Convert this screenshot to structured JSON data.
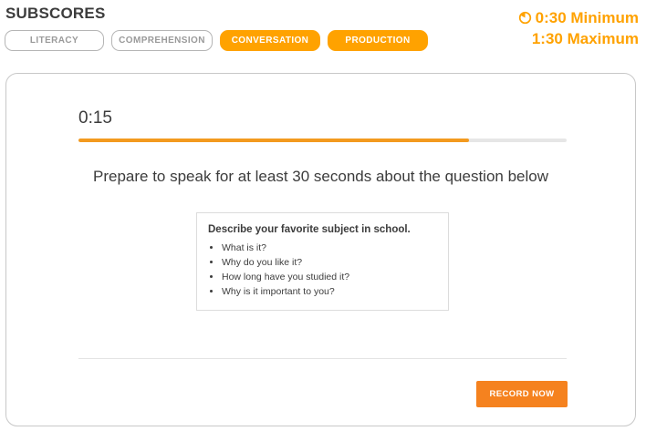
{
  "header": {
    "title": "SUBSCORES"
  },
  "tabs": [
    {
      "label": "LITERACY",
      "active": false
    },
    {
      "label": "COMPREHENSION",
      "active": false
    },
    {
      "label": "CONVERSATION",
      "active": true
    },
    {
      "label": "PRODUCTION",
      "active": true
    }
  ],
  "time_limits": {
    "icon": "clock-icon",
    "minimum": "0:30 Minimum",
    "maximum": "1:30 Maximum"
  },
  "task": {
    "timer": "0:15",
    "progress_fraction": 0.8,
    "instruction": "Prepare to speak for at least 30 seconds about the question below",
    "question": {
      "title": "Describe your favorite subject in school.",
      "bullets": [
        "What is it?",
        "Why do you like it?",
        "How long have you studied it?",
        "Why is it important to you?"
      ]
    },
    "record_button": "RECORD NOW"
  },
  "colors": {
    "accent": "#ffa200",
    "progress": "#f39a1f",
    "record_button": "#f5821f",
    "inactive_border": "#b5b5b5"
  }
}
